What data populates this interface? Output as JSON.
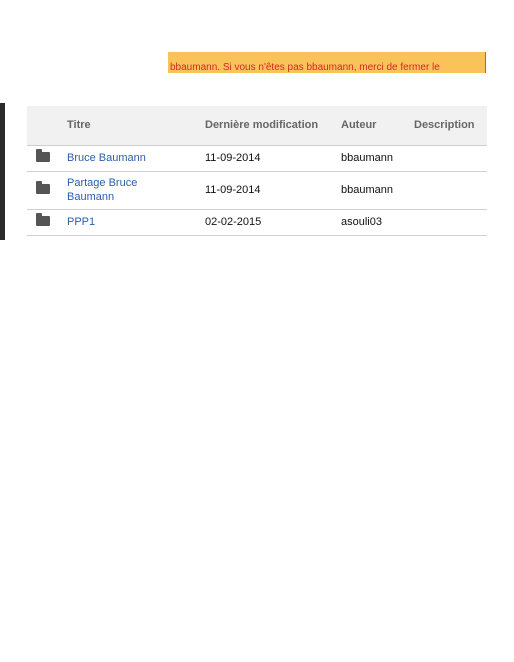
{
  "warning": {
    "text": "bbaumann. Si vous n'êtes pas bbaumann, merci de fermer le"
  },
  "table": {
    "headers": {
      "title": "Titre",
      "modified": "Dernière modification",
      "author": "Auteur",
      "description": "Description"
    },
    "rows": [
      {
        "icon": "folder-icon",
        "title": "Bruce Baumann",
        "modified": "11-09-2014",
        "author": "bbaumann",
        "description": ""
      },
      {
        "icon": "folder-icon",
        "title": "Partage Bruce Baumann",
        "modified": "11-09-2014",
        "author": "bbaumann",
        "description": ""
      },
      {
        "icon": "folder-icon",
        "title": "PPP1",
        "modified": "02-02-2015",
        "author": "asouli03",
        "description": ""
      }
    ]
  },
  "colors": {
    "banner_bg": "#f9c35a",
    "banner_text": "#d22a1e",
    "link": "#2a5db0",
    "header_bg": "#f1f1f1"
  }
}
